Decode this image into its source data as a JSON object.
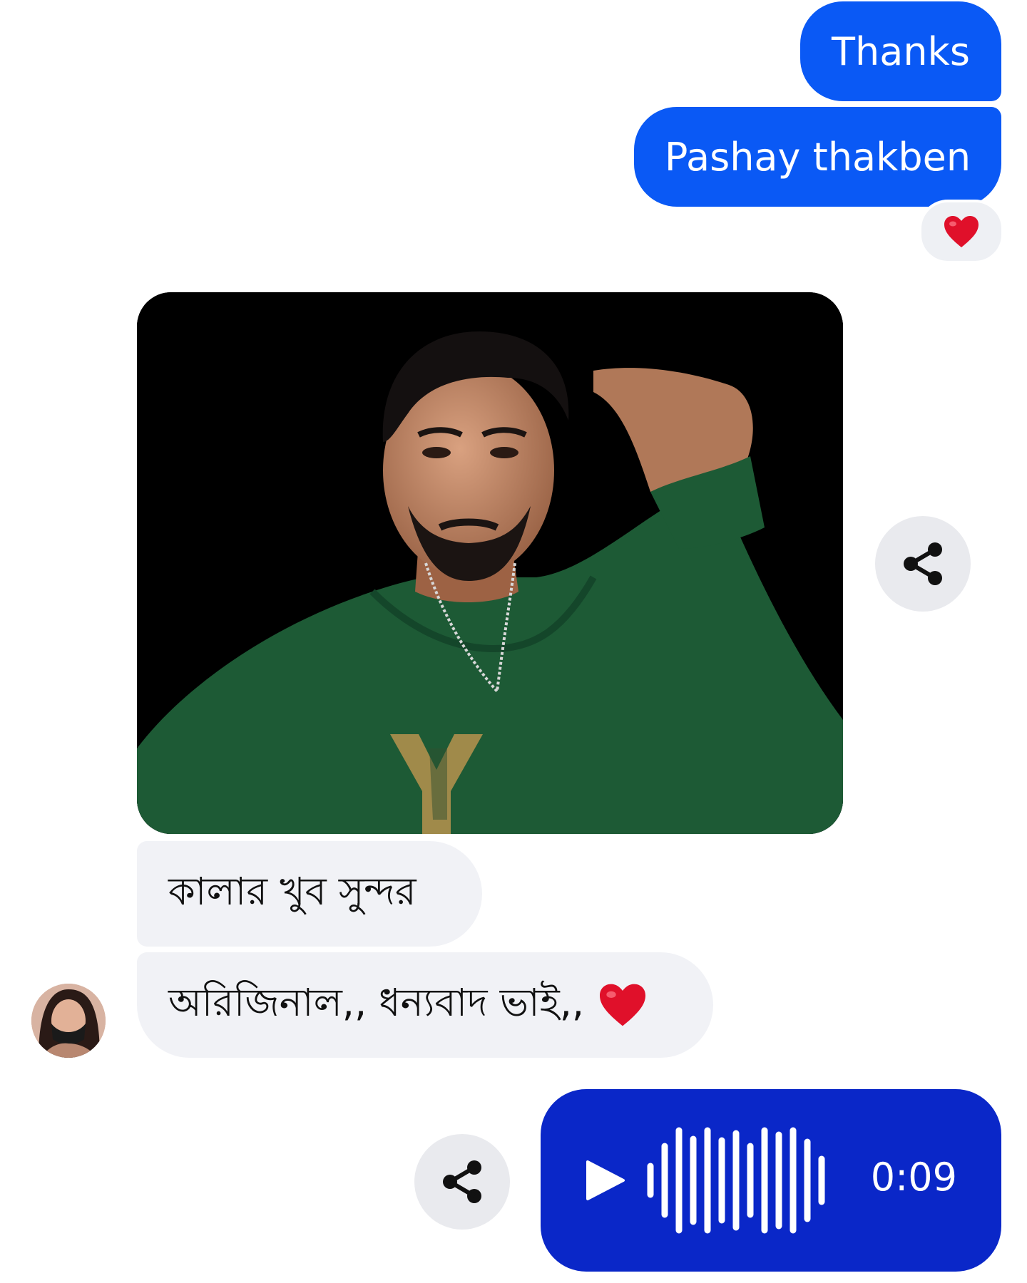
{
  "messages_out": {
    "thanks": "Thanks",
    "pashay": "Pashay thakben"
  },
  "reaction": {
    "icon": "red-heart-icon",
    "color": "#e0102a"
  },
  "messages_in": {
    "color_comment": "কালার খুব সুন্দর",
    "original_comment": "অরিজিনাল,, ধন্যবাদ ভাই,,",
    "emoji_icon": "red-heart-icon"
  },
  "audio": {
    "duration": "0:09",
    "play_icon": "play-icon",
    "waveform_icon": "waveform-icon"
  },
  "colors": {
    "outgoing_bubble": "#0a59f5",
    "audio_bubble": "#0a27c8",
    "incoming_bubble": "#f1f2f6",
    "share_button": "#e9eaee"
  },
  "icons": {
    "share": "share-icon"
  }
}
